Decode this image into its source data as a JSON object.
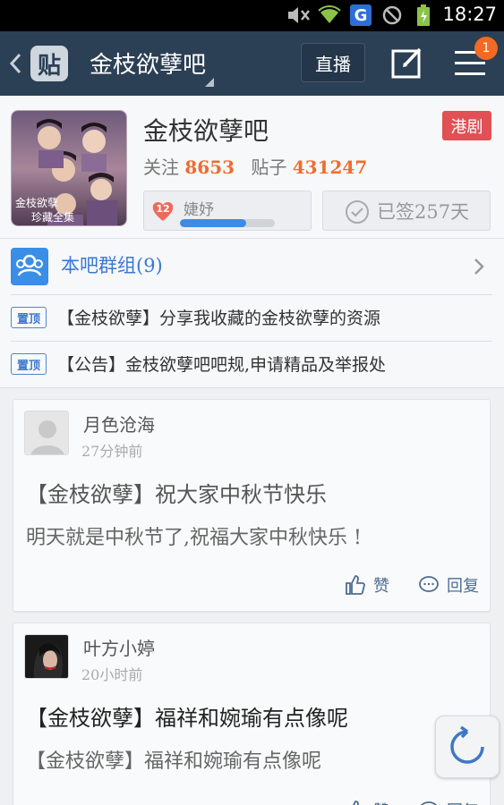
{
  "status_bar": {
    "time": "18:27",
    "icons": [
      "mute-icon",
      "wifi-icon",
      "g-app-icon",
      "blocked-icon",
      "battery-icon"
    ],
    "g_label": "G"
  },
  "nav": {
    "logo_text": "贴",
    "title": "金枝欲孽吧",
    "live_label": "直播",
    "menu_badge": "1"
  },
  "forum": {
    "name": "金枝欲孽吧",
    "tag": "港剧",
    "followers_label": "关注",
    "followers": "8653",
    "posts_label": "贴子",
    "posts": "431247",
    "level": "12",
    "level_name": "婕妤",
    "level_progress": 0.7,
    "signed_label": "已签257天",
    "cover_caption_1": "金枝欲孽",
    "cover_caption_2": "珍藏全集"
  },
  "group": {
    "label": "本吧群组(9)"
  },
  "pinned": [
    {
      "badge": "置顶",
      "text": "【金枝欲孽】分享我收藏的金枝欲孽的资源"
    },
    {
      "badge": "置顶",
      "text": "【公告】金枝欲孽吧吧规,申请精品及举报处"
    }
  ],
  "posts": [
    {
      "author": "月色沧海",
      "time": "27分钟前",
      "title": "【金枝欲孽】祝大家中秋节快乐",
      "body": "明天就是中秋节了,祝福大家中秋快乐 !",
      "like_label": "赞",
      "reply_label": "回复"
    },
    {
      "author": "叶方小婷",
      "time": "20小时前",
      "title": "【金枝欲孽】福祥和婉瑜有点像呢",
      "body": "【金枝欲孽】福祥和婉瑜有点像呢",
      "like_label": "赞",
      "reply_label": "回复"
    }
  ],
  "colors": {
    "nav_bg": "#2b3f55",
    "accent_blue": "#3b8ee6",
    "accent_orange": "#ef6c2d",
    "tag_red": "#e05054"
  }
}
